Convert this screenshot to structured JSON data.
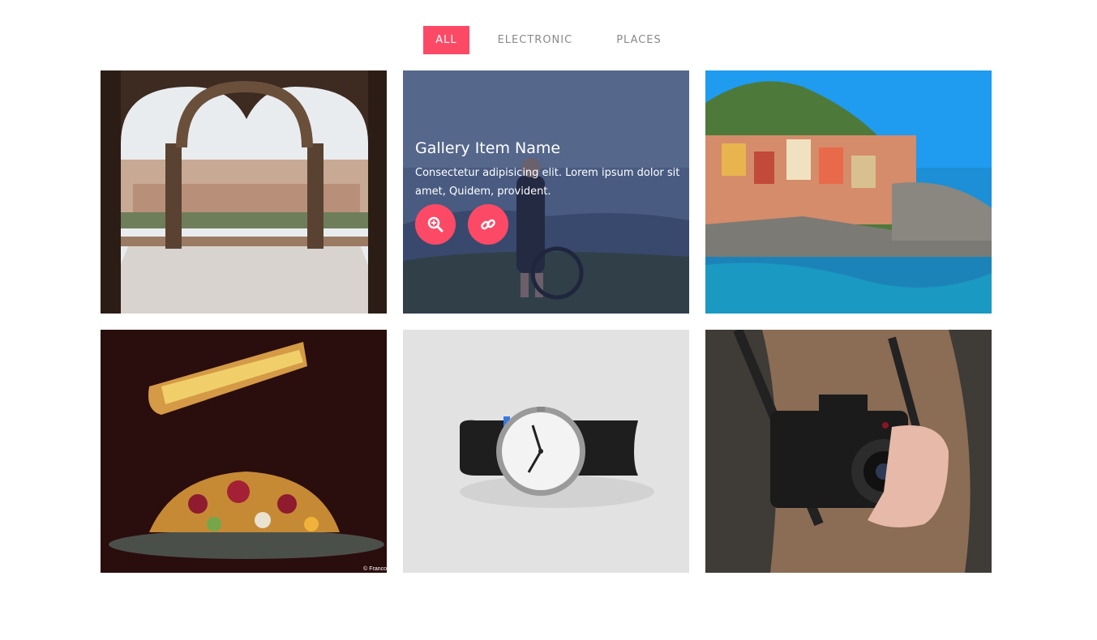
{
  "filters": [
    {
      "label": "ALL",
      "active": true
    },
    {
      "label": "ELECTRONIC",
      "active": false
    },
    {
      "label": "PLACES",
      "active": false
    }
  ],
  "hover_item": {
    "title": "Gallery Item Name",
    "description": "Consectetur adipisicing elit. Lorem ipsum dolor sit amet, Quidem, provident."
  },
  "photo_credit": "© Franco",
  "colors": {
    "accent": "#fc4a66",
    "filter_text": "#8a8a8a"
  }
}
